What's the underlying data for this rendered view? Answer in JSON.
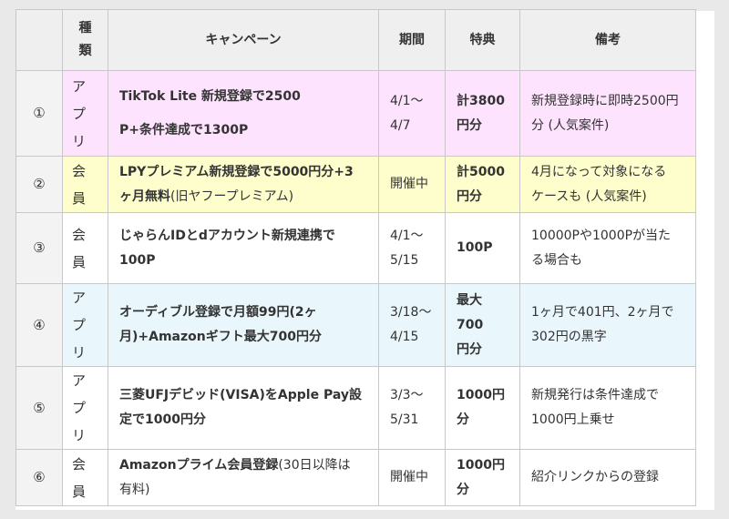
{
  "headers": {
    "num": "",
    "kind_line1": "種",
    "kind_line2": "類",
    "campaign": "キャンペーン",
    "period": "期間",
    "benefit": "特典",
    "notes": "備考"
  },
  "rows": [
    {
      "num": "①",
      "kind_line1": "ア",
      "kind_line2": "プ",
      "kind_line3": "リ",
      "campaign_line1": "TikTok Lite 新規登録で2500",
      "campaign_line2": "P+条件達成で1300P",
      "period_line1": "4/1～",
      "period_line2": "4/7",
      "benefit_line1": "計3800",
      "benefit_line2": "円分",
      "notes_line1": "新規登録時に即時2500円",
      "notes_line2": "分 (人気案件)"
    },
    {
      "num": "②",
      "kind_line1": "会",
      "kind_line2": "員",
      "campaign_bold1": "LPYプレミアム新規登録で5000円分+3",
      "campaign_bold2": "ヶ月無料",
      "campaign_normal": "(旧ヤフープレミアム)",
      "period_line1": "開催中",
      "benefit_line1": "計5000",
      "benefit_line2": "円分",
      "notes_line1": "4月になって対象になる",
      "notes_line2": "ケースも (人気案件)"
    },
    {
      "num": "③",
      "kind_line1": "会",
      "kind_line2": "員",
      "campaign_line1": "じゃらんIDとdアカウント新規連携で",
      "campaign_line2": "100P",
      "period_line1": "4/1～",
      "period_line2": "5/15",
      "benefit_line1": "100P",
      "notes_line1": "10000Pや1000Pが当た",
      "notes_line2": "る場合も"
    },
    {
      "num": "④",
      "kind_line1": "ア",
      "kind_line2": "プ",
      "kind_line3": "リ",
      "campaign_line1": "オーディブル登録で月額99円(2ヶ",
      "campaign_line2": "月)+Amazonギフト最大700円分",
      "period_line1": "3/18～",
      "period_line2": "4/15",
      "benefit_line1": "最大700",
      "benefit_line2": "円分",
      "notes_line1": "1ヶ月で401円、2ヶ月で",
      "notes_line2": "302円の黒字"
    },
    {
      "num": "⑤",
      "kind_line1": "ア",
      "kind_line2": "プ",
      "kind_line3": "リ",
      "campaign_line1": "三菱UFJデビッド(VISA)をApple Pay設",
      "campaign_line2": "定で1000円分",
      "period_line1": "3/3～",
      "period_line2": "5/31",
      "benefit_line1": "1000円",
      "benefit_line2": "分",
      "notes_line1": "新規発行は条件達成で",
      "notes_line2": "1000円上乗せ"
    },
    {
      "num": "⑥",
      "kind_line1": "会",
      "kind_line2": "員",
      "campaign_bold1": "Amazonプライム会員登録",
      "campaign_normal1": "(30日以降は",
      "campaign_normal2": "有料)",
      "period_line1": "開催中",
      "benefit_line1": "1000円",
      "benefit_line2": "分",
      "notes_line1": "紹介リンクからの登録"
    }
  ]
}
